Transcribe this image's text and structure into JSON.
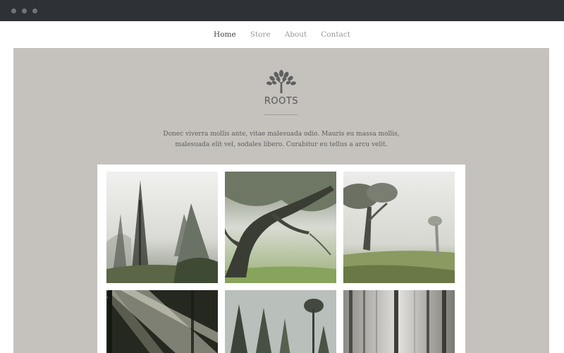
{
  "window": {
    "controls": [
      "close",
      "minimize",
      "maximize"
    ]
  },
  "nav": {
    "items": [
      {
        "label": "Home",
        "active": true
      },
      {
        "label": "Store",
        "active": false
      },
      {
        "label": "About",
        "active": false
      },
      {
        "label": "Contact",
        "active": false
      }
    ]
  },
  "hero": {
    "logo_icon": "tree-icon",
    "brand": "ROOTS",
    "description": "Donec viverra mollis ante, vitae malesuada odio. Mauris eu massa mollis, malesuada elit vel, sodales libero. Curabitur eu tellus a arcu velit."
  },
  "gallery": {
    "photos": [
      {
        "subject": "misty pine tree"
      },
      {
        "subject": "large mossy tree over green field"
      },
      {
        "subject": "twisted trees in fog"
      },
      {
        "subject": "sun rays through forest"
      },
      {
        "subject": "pine trees against pale sky"
      },
      {
        "subject": "tall trunks in misty woods"
      }
    ]
  },
  "colors": {
    "titlebar": "#2e3236",
    "hero_bg": "#c5c2bd",
    "nav_active": "#444444",
    "nav_inactive": "#9a9a9a"
  }
}
